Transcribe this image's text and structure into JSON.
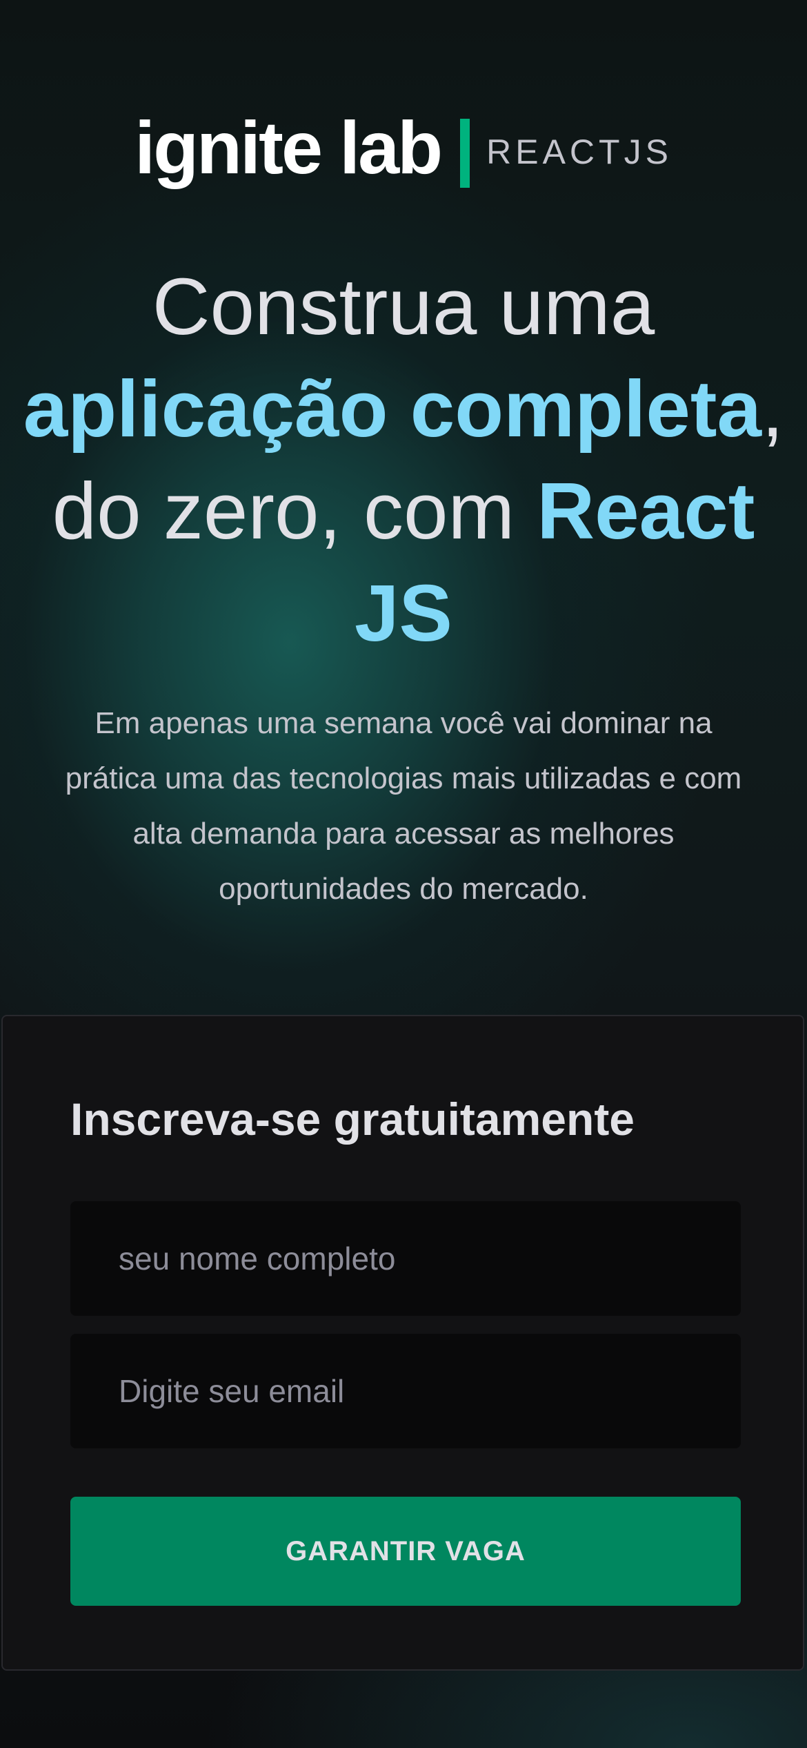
{
  "brand": {
    "logo_text": "ignite lab",
    "sub_text": "REACTJS",
    "accent_color": "#00b37e"
  },
  "hero": {
    "headline": {
      "part1": "Construa uma ",
      "highlight1": "aplicação completa",
      "part2": ", do zero, com ",
      "highlight2": "React JS"
    },
    "highlight_color": "#81d8f7",
    "description": "Em apenas uma semana você vai dominar na prática uma das tecnologias mais utilizadas e com alta demanda para acessar as melhores oportunidades do mercado."
  },
  "signup": {
    "title": "Inscreva-se gratuitamente",
    "name_placeholder": "seu nome completo",
    "email_placeholder": "Digite seu email",
    "submit_label": "GARANTIR VAGA",
    "button_color": "#00875f"
  }
}
